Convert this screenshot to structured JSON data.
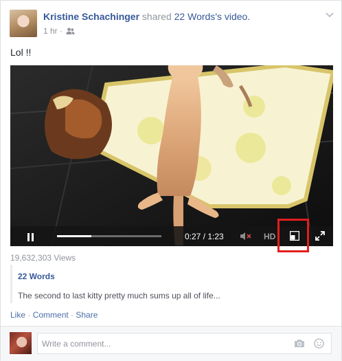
{
  "post": {
    "author": "Kristine Schachinger",
    "verb": " shared ",
    "shared_page": "22 Words",
    "suffix": "'s video.",
    "time": "1 hr",
    "separator": " · ",
    "text": "Lol !!"
  },
  "video": {
    "time_display": "0:27 / 1:23",
    "hd_label": "HD",
    "progress": 0.33,
    "views": "19,632,303 Views"
  },
  "shared_attachment": {
    "title": "22 Words",
    "description": "The second to last kitty pretty much sums up all of life..."
  },
  "actions": {
    "like": "Like",
    "comment": "Comment",
    "share": "Share",
    "dot": " · "
  },
  "comment_box": {
    "placeholder": "Write a comment..."
  },
  "icons": {
    "options": "chevron-down-icon",
    "audience": "friends-icon",
    "play_state": "pause-icon",
    "volume": "mute-icon",
    "popout": "popout-icon",
    "fullscreen": "fullscreen-icon",
    "camera": "camera-icon",
    "emoji": "smiley-icon"
  },
  "colors": {
    "link": "#365899",
    "meta": "#90949c",
    "highlight_box": "#e31d1d"
  }
}
